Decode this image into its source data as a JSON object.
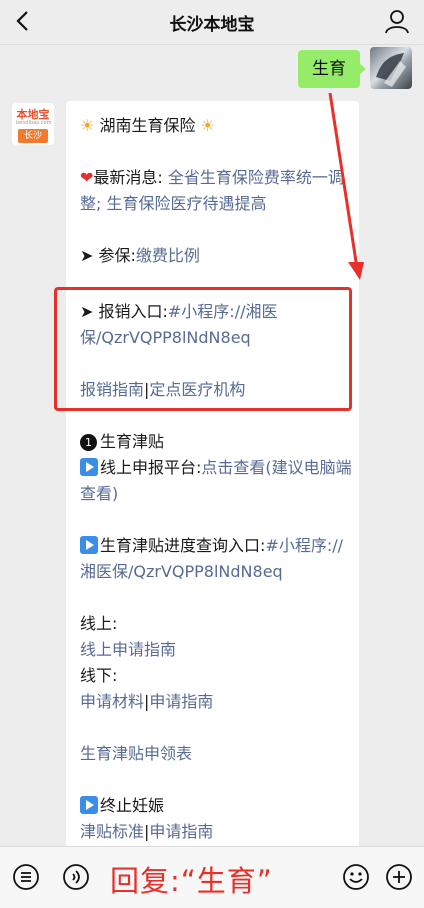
{
  "nav": {
    "title": "长沙本地宝",
    "back_icon": "back-chevron-icon",
    "user_icon": "user-profile-icon"
  },
  "user_message": {
    "text": "生育"
  },
  "bot": {
    "logo_text": "本地宝",
    "logo_sub": "bendibao.com",
    "badge": "长沙"
  },
  "article": {
    "title_text": "湖南生育保险",
    "news_label": "最新消息:",
    "news_link1": "全省生育保险费率统一调整",
    "news_sep": ";",
    "news_link2": "生育保险医疗待遇提高",
    "join_label": "➤ 参保:",
    "join_link": "缴费比例",
    "claim_label": "➤ 报销入口:",
    "claim_value": "#小程序://湘医保/QzrVQPP8lNdN8eq",
    "claim_link1": "报销指南",
    "claim_link2": "定点医疗机构",
    "allowance_num": "1",
    "allowance_title": "生育津贴",
    "online_platform_label": "线上申报平台:",
    "online_platform_link": "点击查看(建议电脑端查看)",
    "progress_label": "生育津贴进度查询入口:",
    "progress_value": "#小程序://湘医保/QzrVQPP8lNdN8eq",
    "online_label": "线上:",
    "online_link": "线上申请指南",
    "offline_label": "线下:",
    "offline_link1": "申请材料",
    "offline_link2": "申请指南",
    "collect_link": "生育津贴申领表",
    "termination_title": "终止妊娠",
    "termination_link1": "津贴标准",
    "termination_link2": "申请指南",
    "divider": "|"
  },
  "bottom_bar": {
    "reply_text": "回复:“生育”",
    "icons": [
      "menu-list-icon",
      "voice-icon",
      "emoji-icon",
      "plus-icon"
    ]
  },
  "colors": {
    "link": "#576b95",
    "highlight_red": "#e8302a",
    "bubble_green": "#95ec69"
  }
}
